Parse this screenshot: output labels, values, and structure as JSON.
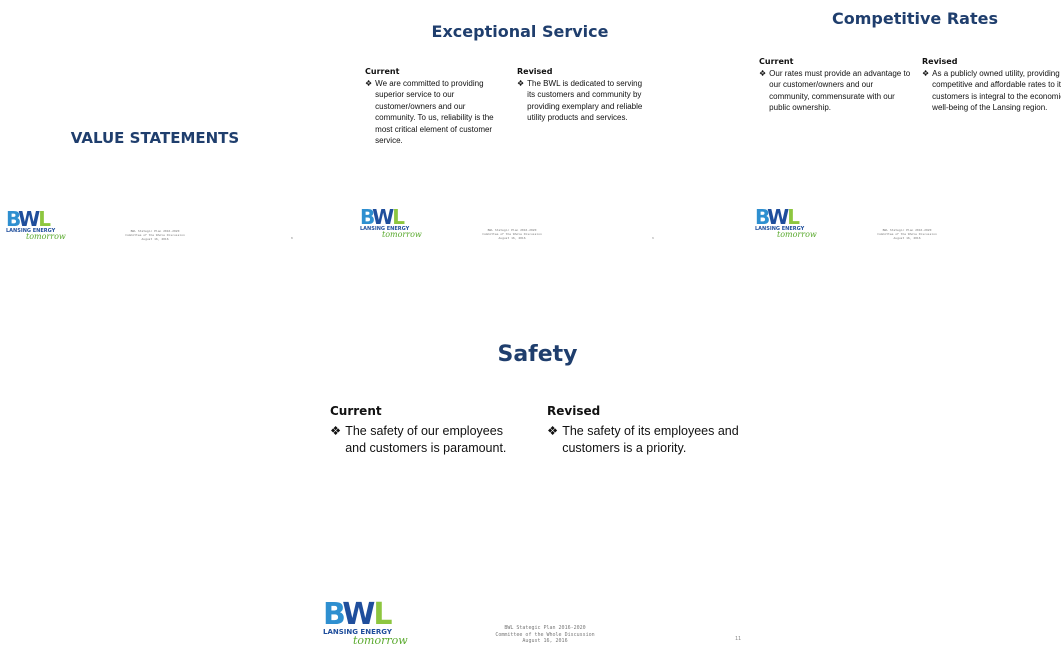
{
  "footer_lines": [
    "BWL Stategic  Plan 2016-2020",
    "Committee of the Whole Discussion",
    "August 16, 2016"
  ],
  "logo": {
    "letters": [
      "B",
      "W",
      "L"
    ],
    "line1": "LANSING ENERGY",
    "line2": "tomorrow"
  },
  "slides": [
    {
      "title": "VALUE STATEMENTS",
      "page": "8"
    },
    {
      "title": "Exceptional Service",
      "page": "9",
      "current_head": "Current",
      "current_text": "We are committed to providing superior service to our customer/owners and our community.  To us, reliability is the most critical element of customer service.",
      "revised_head": "Revised",
      "revised_text": "The BWL is dedicated to serving its customers and community by providing exemplary and reliable utility products and services."
    },
    {
      "title": "Competitive Rates",
      "current_head": "Current",
      "current_text": "Our rates must provide an advantage to our customer/owners and our community, commensurate with our public ownership.",
      "revised_head": "Revised",
      "revised_text": "As a publicly owned utility, providing competitive and affordable rates to its customers is integral to the economic well-being of the Lansing region."
    },
    {
      "title": "Safety",
      "page": "11",
      "current_head": "Current",
      "current_text": "The safety of our employees and customers is paramount.",
      "revised_head": "Revised",
      "revised_text": "The safety of its employees and customers is a priority."
    }
  ],
  "bullet_glyph": "❖",
  "colors": {
    "title": "#1f3e6d",
    "logo_blue": "#2e8fd0",
    "logo_navy": "#1f4e9c",
    "logo_green": "#8dc63f"
  }
}
